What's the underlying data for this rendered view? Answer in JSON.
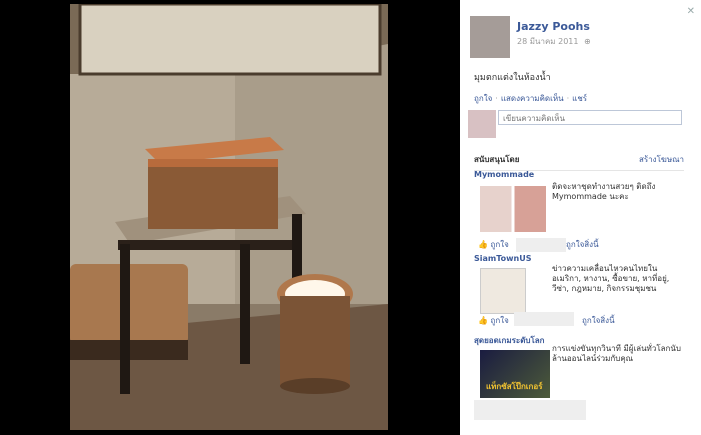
{
  "post": {
    "author": "Jazzy Poohs",
    "date": "28 มีนาคม 2011",
    "caption": "มุมตกแต่งในห้องน้ำ",
    "actions": {
      "like": "ถูกใจ",
      "comment": "แสดงความคิดเห็น",
      "share": "แชร์"
    },
    "comment_placeholder": "เขียนความคิดเห็น"
  },
  "sponsored": {
    "title": "สนับสนุนโดย",
    "create_ad": "สร้างโฆษณา",
    "ads": [
      {
        "name": "Mymommade",
        "text": "ติดจะหาชุดทำงานสวยๆ ติดถึง Mymommade นะคะ",
        "like": "ถูกใจ",
        "like_page": "ถูกใจสิ่งนี้"
      },
      {
        "name": "SiamTownUS",
        "text": "ข่าวความเคลื่อนไหวคนไทยในอเมริกา, หางาน, ซื้อขาย, หาที่อยู่, วีซ่า, กฎหมาย, กิจกรรมชุมชน",
        "like": "ถูกใจ",
        "like_page": "ถูกใจสิ่งนี้"
      },
      {
        "name": "สุดยอดเกมระดับโลก",
        "text": "การแข่งขันทุกวินาที มีผู้เล่นทั่วโลกนับล้านออนไลน์ร่วมกับคุณ",
        "image_caption": "แท็กซัสโป๊กเกอร์"
      }
    ]
  },
  "icons": {
    "close": "close-icon",
    "globe": "globe-icon",
    "thumb": "thumbs-up-icon"
  }
}
